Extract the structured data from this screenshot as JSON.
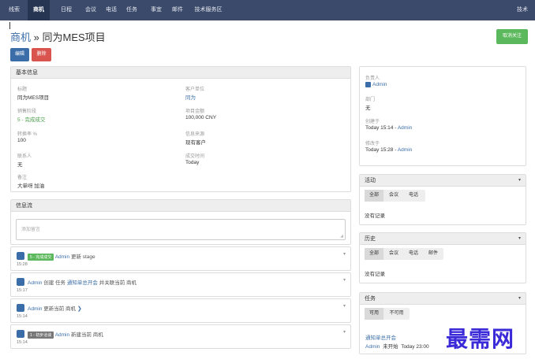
{
  "nav": {
    "items": [
      "线索",
      "商机",
      "日程",
      "会议",
      "电话",
      "任务",
      "事宜",
      "邮件",
      "技术服务区"
    ],
    "active_index": 1,
    "right": "技术"
  },
  "header": {
    "crumb": "商机",
    "sep": "»",
    "title": "同为MES项目",
    "unfollow": "取消关注",
    "edit": "编辑",
    "delete": "删除"
  },
  "basic": {
    "title": "基本信息",
    "name_label": "标题",
    "name_value": "同为MES项目",
    "customer_label": "客户单位",
    "customer_value": "同为",
    "stage_label": "销售阶段",
    "stage_value": "5 - 完成成交",
    "amount_label": "项目金额",
    "amount_value": "100,000 CNY",
    "prob_label": "转换率 %",
    "prob_value": "100",
    "source_label": "信息来源",
    "source_value": "现有客户",
    "contact_label": "联系人",
    "contact_value": "无",
    "close_label": "成交时间",
    "close_value": "Today",
    "remark_label": "备注",
    "remark_value": "大单呀 加油"
  },
  "stream": {
    "title": "信息流",
    "placeholder": "添加留言",
    "items": [
      {
        "tag": "5 - 完成成交",
        "user": "Admin",
        "text": "更新 stage",
        "time": "15:28"
      },
      {
        "user": "Admin",
        "pre": "创建 任务",
        "link": "通知单总开会",
        "post": "并关联当前 商机",
        "time": "15:17"
      },
      {
        "user": "Admin",
        "text": "更新当前 商机",
        "time": "15:14"
      },
      {
        "tag": "1 - 初步洽谈",
        "user": "Admin",
        "text": "新建当前 商机",
        "time": "15:14"
      }
    ]
  },
  "side_info": {
    "owner_label": "负责人",
    "owner_value": "Admin",
    "dept_label": "部门",
    "dept_value": "无",
    "created_label": "创建于",
    "created_value": "Today 15:14 -",
    "created_by": "Admin",
    "modified_label": "修改于",
    "modified_value": "Today 15:28 -",
    "modified_by": "Admin"
  },
  "activity": {
    "title": "活动",
    "tabs": [
      "全部",
      "会议",
      "电话"
    ],
    "empty": "没有记录"
  },
  "history": {
    "title": "历史",
    "tabs": [
      "全部",
      "会议",
      "电话",
      "邮件"
    ],
    "empty": "没有记录"
  },
  "tasks": {
    "title": "任务",
    "tabs": [
      "可用",
      "不可用"
    ],
    "task_name": "通知单总开会",
    "task_user": "Admin",
    "task_status": "未开始",
    "task_time": "Today 23:00"
  },
  "icons": {
    "caret": "caret-down-icon",
    "avatar": "user-avatar-icon",
    "chevron": "chevron-down-icon"
  },
  "colors": {
    "nav": "#3b4a6b",
    "link": "#3b6ea8",
    "green": "#5cb85c",
    "red": "#d9534f"
  },
  "watermark": "最需网"
}
